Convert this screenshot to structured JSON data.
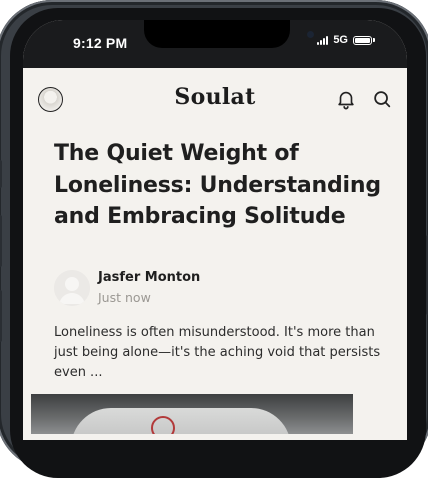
{
  "status_bar": {
    "time": "9:12 PM",
    "network": "5G"
  },
  "app_bar": {
    "title": "Soulat",
    "icons": [
      "profile-avatar",
      "bell-icon",
      "search-icon"
    ]
  },
  "article": {
    "headline": "The Quiet Weight of Loneliness: Understanding and Embracing Solitude",
    "author": {
      "name": "Jasfer Monton",
      "time": "Just now"
    },
    "excerpt": "Loneliness is often misunderstood. It's more than just being alone—it's the aching void that persists even ..."
  },
  "colors": {
    "background": "#f4f2ee",
    "text": "#1f1f1f",
    "muted": "#9b9893",
    "status_bar": "#1a1b1d"
  }
}
